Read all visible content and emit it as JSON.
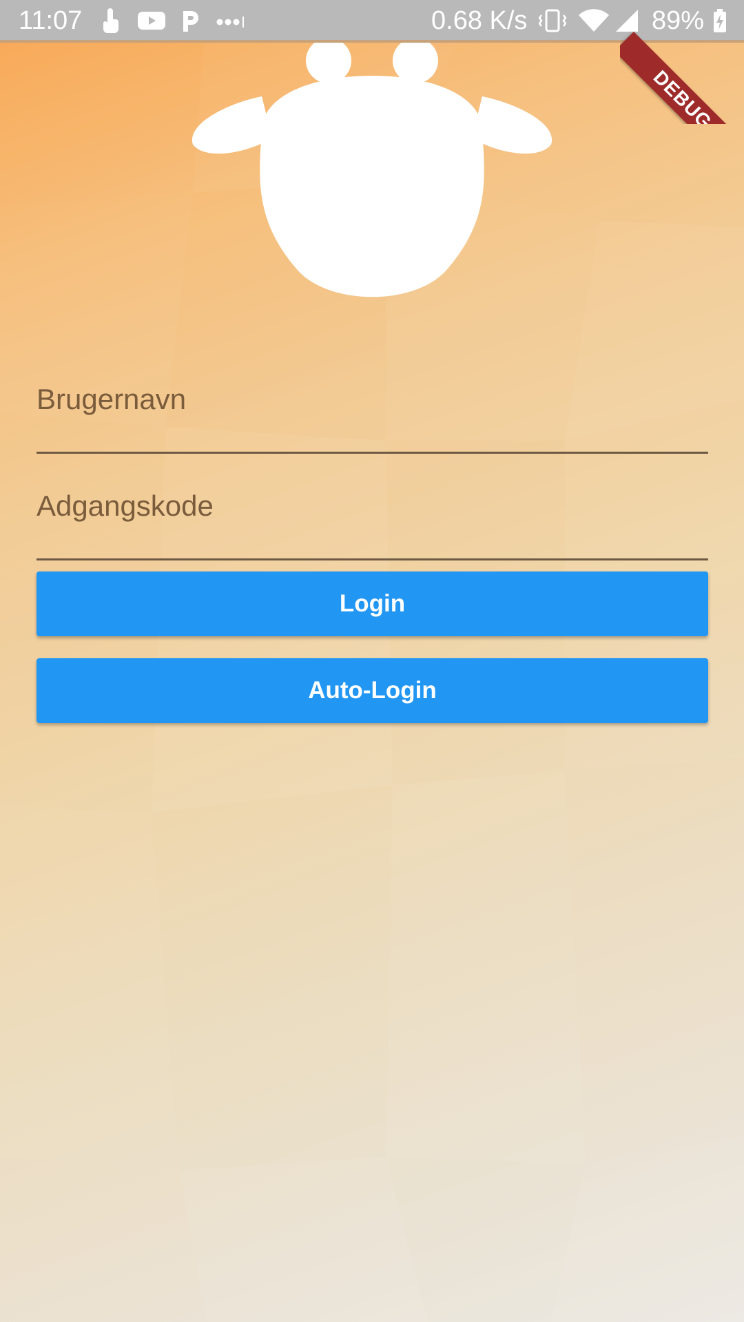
{
  "status_bar": {
    "time": "11:07",
    "network_speed": "0.68 K/s",
    "battery_percent": "89%",
    "left_icons": [
      "touch-icon",
      "youtube-icon",
      "p-app-icon",
      "more-notifications-icon"
    ],
    "right_icons": [
      "vibrate-icon",
      "wifi-icon",
      "signal-icon",
      "battery-charging-icon"
    ]
  },
  "debug_banner": {
    "label": "DEBUG",
    "color": "#9e2a2a"
  },
  "logo": {
    "icon": "sheep-logo-icon",
    "color": "#ffffff"
  },
  "login_form": {
    "username": {
      "placeholder": "Brugernavn",
      "value": ""
    },
    "password": {
      "placeholder": "Adgangskode",
      "value": ""
    },
    "login_button": {
      "label": "Login"
    },
    "auto_login_button": {
      "label": "Auto-Login"
    }
  },
  "colors": {
    "button": "#2196f3",
    "button_text": "#ffffff",
    "field_text": "#7a5c3c",
    "underline": "#6e5a44",
    "background_top": "#f8a24a",
    "background_bottom": "#ece8e2"
  }
}
